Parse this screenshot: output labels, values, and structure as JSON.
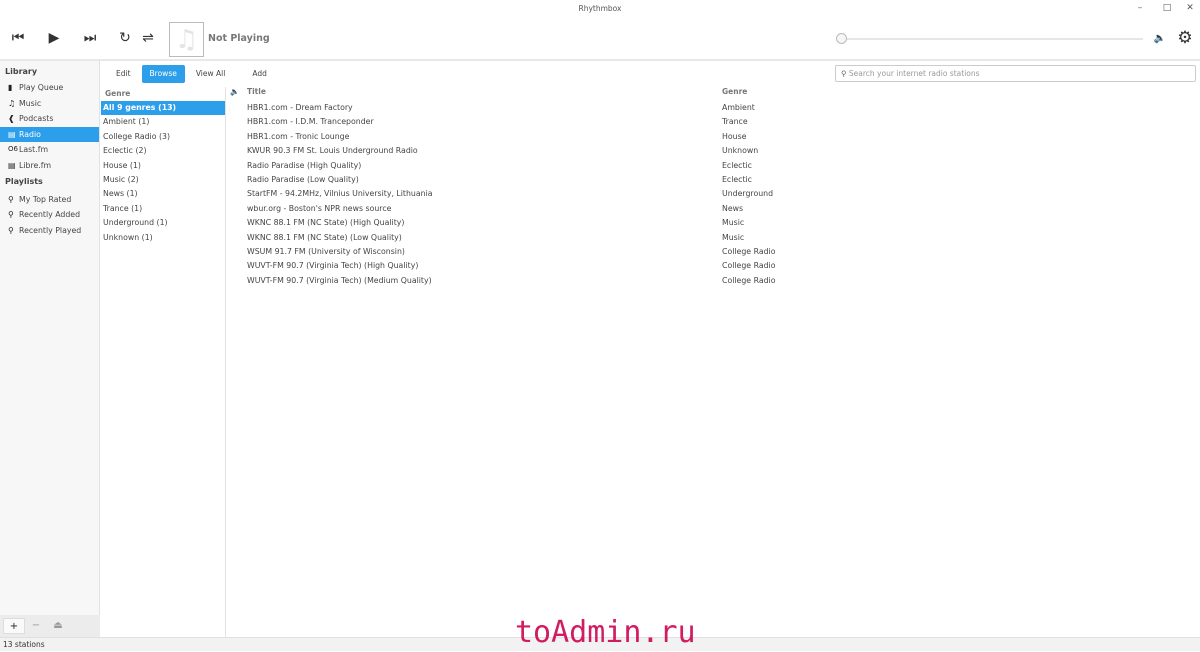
{
  "window": {
    "title": "Rhythmbox"
  },
  "player": {
    "now_playing": "Not Playing"
  },
  "sidebar": {
    "library_heading": "Library",
    "library": [
      {
        "label": "Play Queue",
        "icon": "document-icon"
      },
      {
        "label": "Music",
        "icon": "music-note-icon"
      },
      {
        "label": "Podcasts",
        "icon": "rss-icon"
      },
      {
        "label": "Radio",
        "icon": "radio-icon",
        "selected": true
      },
      {
        "label": "Last.fm",
        "icon": "lastfm-icon"
      },
      {
        "label": "Libre.fm",
        "icon": "librefm-icon"
      }
    ],
    "playlists_heading": "Playlists",
    "playlists": [
      {
        "label": "My Top Rated"
      },
      {
        "label": "Recently Added"
      },
      {
        "label": "Recently Played"
      }
    ]
  },
  "tabs": [
    "Edit",
    "Browse",
    "View All",
    "Add"
  ],
  "search": {
    "placeholder": "Search your internet radio stations"
  },
  "genre_pane": {
    "header": "Genre",
    "items": [
      "All 9 genres (13)",
      "Ambient (1)",
      "College Radio (3)",
      "Eclectic (2)",
      "House (1)",
      "Music (2)",
      "News (1)",
      "Trance (1)",
      "Underground (1)",
      "Unknown (1)"
    ]
  },
  "tracks": {
    "headers": {
      "title": "Title",
      "genre": "Genre"
    },
    "rows": [
      {
        "title": "HBR1.com - Dream Factory",
        "genre": "Ambient"
      },
      {
        "title": "HBR1.com - I.D.M. Tranceponder",
        "genre": "Trance"
      },
      {
        "title": "HBR1.com - Tronic Lounge",
        "genre": "House"
      },
      {
        "title": "KWUR 90.3 FM St. Louis Underground Radio",
        "genre": "Unknown"
      },
      {
        "title": "Radio Paradise (High Quality)",
        "genre": "Eclectic"
      },
      {
        "title": "Radio Paradise (Low Quality)",
        "genre": "Eclectic"
      },
      {
        "title": "StartFM - 94.2MHz, Vilnius University, Lithuania",
        "genre": "Underground"
      },
      {
        "title": "wbur.org - Boston's NPR news source",
        "genre": "News"
      },
      {
        "title": "WKNC 88.1 FM (NC State) (High Quality)",
        "genre": "Music"
      },
      {
        "title": "WKNC 88.1 FM (NC State) (Low Quality)",
        "genre": "Music"
      },
      {
        "title": "WSUM 91.7 FM (University of Wisconsin)",
        "genre": "College Radio"
      },
      {
        "title": "WUVT-FM 90.7 (Virginia Tech) (High Quality)",
        "genre": "College Radio"
      },
      {
        "title": "WUVT-FM 90.7 (Virginia Tech) (Medium Quality)",
        "genre": "College Radio"
      }
    ]
  },
  "status": "13 stations",
  "watermark": "toAdmin.ru",
  "colors": {
    "accent": "#2d9fea"
  }
}
